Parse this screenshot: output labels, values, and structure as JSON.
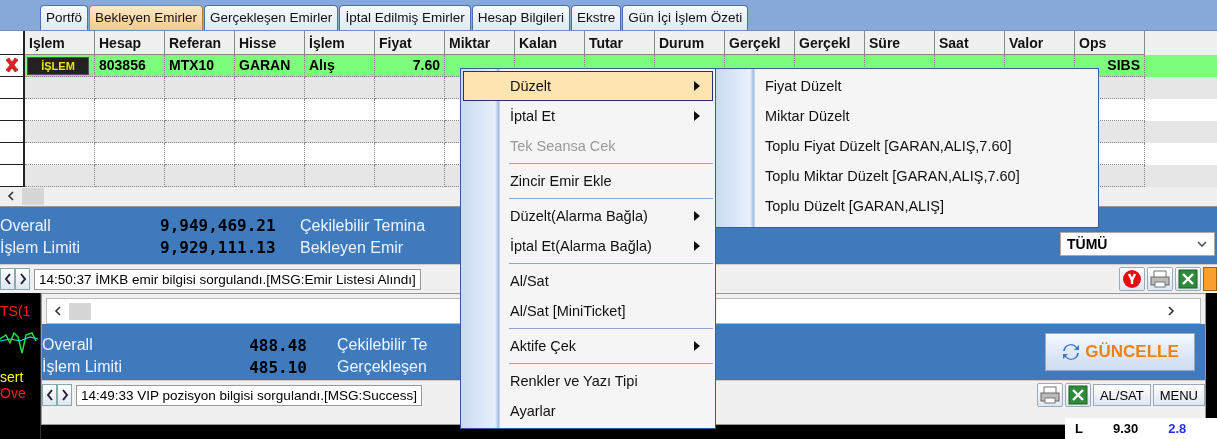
{
  "tabs": [
    {
      "label": "Portfö",
      "selected": false
    },
    {
      "label": "Bekleyen Emirler",
      "selected": true
    },
    {
      "label": "Gerçekleşen Emirler",
      "selected": false
    },
    {
      "label": "İptal Edilmiş Emirler",
      "selected": false
    },
    {
      "label": "Hesap Bilgileri",
      "selected": false
    },
    {
      "label": "Ekstre",
      "selected": false
    },
    {
      "label": "Gün İçi İşlem Özeti",
      "selected": false
    }
  ],
  "orders": {
    "columns": [
      {
        "label": "Işlem",
        "kind": "button"
      },
      {
        "label": "Hesap",
        "kind": "text"
      },
      {
        "label": "Referan",
        "kind": "text"
      },
      {
        "label": "Hisse",
        "kind": "text"
      },
      {
        "label": "İşlem",
        "kind": "text"
      },
      {
        "label": "Fiyat",
        "kind": "number"
      },
      {
        "label": "Miktar",
        "kind": "number"
      },
      {
        "label": "Kalan",
        "kind": "number"
      },
      {
        "label": "Tutar",
        "kind": "number"
      },
      {
        "label": "Durum",
        "kind": "text"
      },
      {
        "label": "Gerçekl",
        "kind": "number"
      },
      {
        "label": "Gerçekl",
        "kind": "number"
      },
      {
        "label": "Süre",
        "kind": "text"
      },
      {
        "label": "Saat",
        "kind": "text"
      },
      {
        "label": "Valor",
        "kind": "number"
      },
      {
        "label": "Ops",
        "kind": "number"
      }
    ],
    "rows": [
      {
        "selected": true,
        "cells": [
          "İŞLEM",
          "803856",
          "MTX10",
          "GARAN",
          "Alış",
          "7.60"
        ],
        "ops": "SIBS"
      }
    ]
  },
  "summary": {
    "rows": [
      {
        "label": "Overall",
        "value": "9,949,469.21",
        "label_2": "Çekilebilir Temina"
      },
      {
        "label": "İşlem Limiti",
        "value": "9,929,111.13",
        "label_2": "Bekleyen Emir"
      }
    ],
    "filter": "TÜMÜ"
  },
  "status": "14:50:37 İMKB emir bilgisi sorgulandı.[MSG:Emir Listesi Alındı]",
  "position": {
    "rows": [
      {
        "label": "Overall",
        "value": "488.48",
        "label_2": "Çekilebilir Te"
      },
      {
        "label": "İşlem Limiti",
        "value": "485.10",
        "label_2": "Gerçekleşen"
      }
    ],
    "update_button": "GÜNCELLE",
    "status": "14:49:33 VIP pozisyon bilgisi sorgulandı.[MSG:Success]",
    "buttons": [
      "AL/SAT",
      "MENU"
    ]
  },
  "side_chart": {
    "labels": [
      {
        "text": "TS(1",
        "color": "#ff2020"
      },
      {
        "text": "sert",
        "color": "#ffff00"
      },
      {
        "text": "Ove",
        "color": "#ff2020"
      }
    ]
  },
  "quote": {
    "labels": [
      "L",
      "9.30",
      "2.8"
    ]
  },
  "context_menu": [
    {
      "kind": "item",
      "label": "Düzelt",
      "submenu": true,
      "selected": true,
      "disabled": false
    },
    {
      "kind": "item",
      "label": "İptal Et",
      "submenu": true,
      "selected": false,
      "disabled": false
    },
    {
      "kind": "item",
      "label": "Tek Seansa Cek",
      "submenu": false,
      "selected": false,
      "disabled": true
    },
    {
      "kind": "separator"
    },
    {
      "kind": "item",
      "label": "Zincir Emir Ekle",
      "submenu": false,
      "selected": false,
      "disabled": false
    },
    {
      "kind": "separator"
    },
    {
      "kind": "item",
      "label": "Düzelt(Alarma Bağla)",
      "submenu": true,
      "selected": false,
      "disabled": false
    },
    {
      "kind": "item",
      "label": "İptal Et(Alarma Bağla)",
      "submenu": true,
      "selected": false,
      "disabled": false
    },
    {
      "kind": "separator"
    },
    {
      "kind": "item",
      "label": "Al/Sat",
      "submenu": false,
      "selected": false,
      "disabled": false
    },
    {
      "kind": "item",
      "label": "Al/Sat [MiniTicket]",
      "submenu": false,
      "selected": false,
      "disabled": false
    },
    {
      "kind": "separator"
    },
    {
      "kind": "item",
      "label": "Aktife Çek",
      "submenu": true,
      "selected": false,
      "disabled": false
    },
    {
      "kind": "separator"
    },
    {
      "kind": "item",
      "label": "Renkler ve Yazı Tipi",
      "submenu": false,
      "selected": false,
      "disabled": false
    },
    {
      "kind": "item",
      "label": "Ayarlar",
      "submenu": false,
      "selected": false,
      "disabled": false
    }
  ],
  "submenu": [
    "Fiyat Düzelt",
    "Miktar Düzelt",
    "Toplu Fiyat Düzelt [GARAN,ALIŞ,7.60]",
    "Toplu Miktar Düzelt [GARAN,ALIŞ,7.60]",
    "Toplu Düzelt [GARAN,ALIŞ]"
  ]
}
